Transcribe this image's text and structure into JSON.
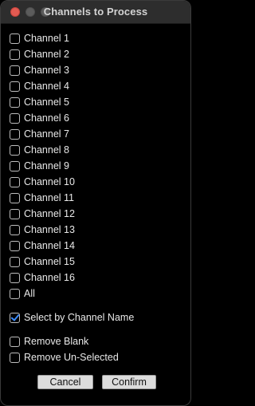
{
  "window": {
    "title": "Channels to Process"
  },
  "channels": [
    {
      "label": "Channel 1",
      "checked": false
    },
    {
      "label": "Channel 2",
      "checked": false
    },
    {
      "label": "Channel 3",
      "checked": false
    },
    {
      "label": "Channel 4",
      "checked": false
    },
    {
      "label": "Channel 5",
      "checked": false
    },
    {
      "label": "Channel 6",
      "checked": false
    },
    {
      "label": "Channel 7",
      "checked": false
    },
    {
      "label": "Channel 8",
      "checked": false
    },
    {
      "label": "Channel 9",
      "checked": false
    },
    {
      "label": "Channel 10",
      "checked": false
    },
    {
      "label": "Channel 11",
      "checked": false
    },
    {
      "label": "Channel 12",
      "checked": false
    },
    {
      "label": "Channel 13",
      "checked": false
    },
    {
      "label": "Channel 14",
      "checked": false
    },
    {
      "label": "Channel 15",
      "checked": false
    },
    {
      "label": "Channel 16",
      "checked": false
    },
    {
      "label": "All",
      "checked": false
    }
  ],
  "options": {
    "select_by_name": {
      "label": "Select by Channel Name",
      "checked": true
    },
    "remove_blank": {
      "label": "Remove Blank",
      "checked": false
    },
    "remove_unselected": {
      "label": "Remove Un-Selected",
      "checked": false
    }
  },
  "buttons": {
    "cancel": "Cancel",
    "confirm": "Confirm"
  },
  "colors": {
    "background": "#000000",
    "titlebar": "#2d2d2d",
    "check_accent": "#3b8cff",
    "close_button": "#e25b52"
  }
}
